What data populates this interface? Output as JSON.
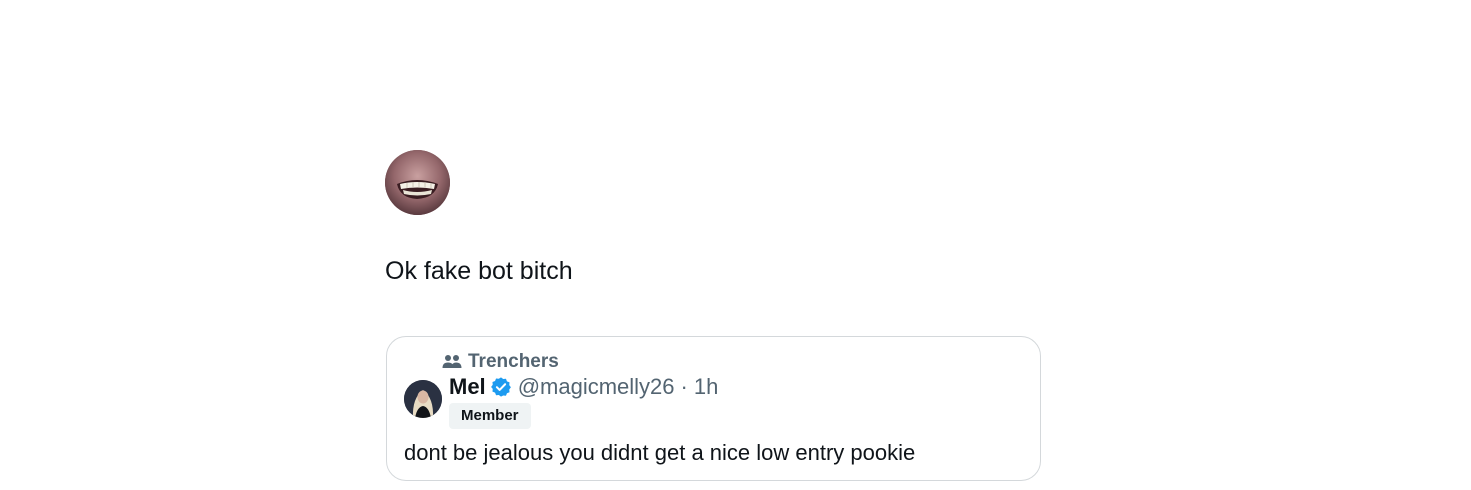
{
  "tweet": {
    "text": "Ok fake bot bitch"
  },
  "quote": {
    "community": "Trenchers",
    "author": {
      "name": "Mel",
      "handle": "@magicmelly26",
      "separator": "·",
      "timestamp": "1h",
      "badge": "Member",
      "verified_color": "#1d9bf0"
    },
    "text": "dont be jealous you didnt get a nice low entry pookie"
  },
  "icons": {
    "community": "community-people-icon",
    "verified": "verified-badge-icon"
  },
  "colors": {
    "primary_text": "#0f1419",
    "secondary_text": "#536471",
    "card_border": "#d4d8db",
    "badge_bg": "#eff3f4"
  }
}
